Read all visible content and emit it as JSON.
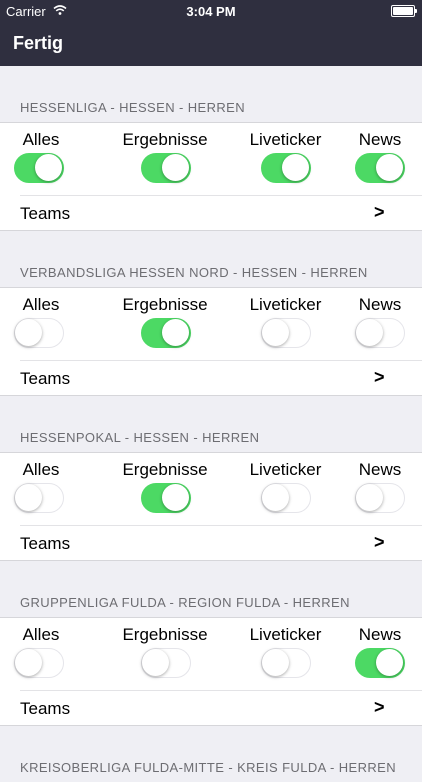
{
  "status_bar": {
    "carrier": "Carrier",
    "time": "3:04 PM"
  },
  "nav": {
    "done_label": "Fertig"
  },
  "toggle_labels": {
    "all": "Alles",
    "results": "Ergebnisse",
    "liveticker": "Liveticker",
    "news": "News"
  },
  "teams_label": "Teams",
  "teams_arrow": ">",
  "colors": {
    "switch_on": "#4cd964",
    "nav_background": "#2f2f3f"
  },
  "sections": [
    {
      "title": "HESSENLIGA - HESSEN - HERREN",
      "alles": true,
      "ergebnisse": true,
      "liveticker": true,
      "news": true
    },
    {
      "title": "VERBANDSLIGA HESSEN NORD - HESSEN - HERREN",
      "alles": false,
      "ergebnisse": true,
      "liveticker": false,
      "news": false
    },
    {
      "title": "HESSENPOKAL - HESSEN - HERREN",
      "alles": false,
      "ergebnisse": true,
      "liveticker": false,
      "news": false
    },
    {
      "title": "GRUPPENLIGA FULDA - REGION FULDA - HERREN",
      "alles": false,
      "ergebnisse": false,
      "liveticker": false,
      "news": true
    },
    {
      "title": "KREISOBERLIGA FULDA-MITTE - KREIS FULDA - HERREN"
    }
  ]
}
